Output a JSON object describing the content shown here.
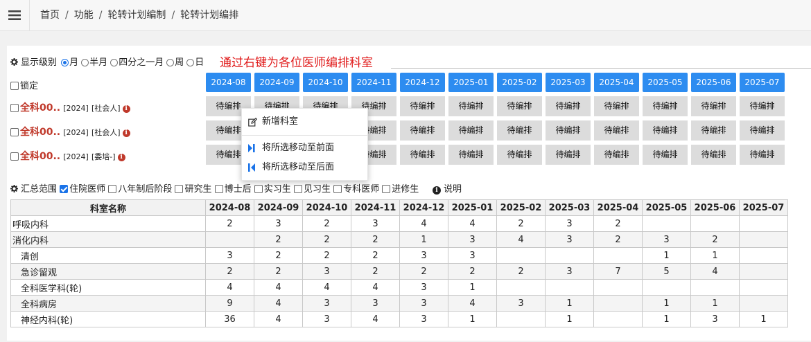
{
  "breadcrumb": [
    "首页",
    "功能",
    "轮转计划编制",
    "轮转计划编排"
  ],
  "display_level": {
    "label": "显示级别",
    "options": [
      "月",
      "半月",
      "四分之一月",
      "周",
      "日"
    ],
    "selected": "月"
  },
  "hint": "通过右键为各位医师编排科室",
  "lock_label": "锁定",
  "months": [
    "2024-08",
    "2024-09",
    "2024-10",
    "2024-11",
    "2024-12",
    "2025-01",
    "2025-02",
    "2025-03",
    "2025-04",
    "2025-05",
    "2025-06",
    "2025-07"
  ],
  "pending_label": "待编排",
  "doctors": [
    {
      "name": "全科00..",
      "year": "[2024]",
      "type": "[社会人]"
    },
    {
      "name": "全科00..",
      "year": "[2024]",
      "type": "[社会人]"
    },
    {
      "name": "全科00..",
      "year": "[2024]",
      "type": "[委培-]"
    }
  ],
  "context_menu": {
    "items": [
      "新增科室",
      "将所选移动至前面",
      "将所选移动至后面"
    ]
  },
  "summary": {
    "label": "汇总范围",
    "filters": [
      {
        "label": "住院医师",
        "checked": true
      },
      {
        "label": "八年制后阶段",
        "checked": false
      },
      {
        "label": "研究生",
        "checked": false
      },
      {
        "label": "博士后",
        "checked": false
      },
      {
        "label": "实习生",
        "checked": false
      },
      {
        "label": "见习生",
        "checked": false
      },
      {
        "label": "专科医师",
        "checked": false
      },
      {
        "label": "进修生",
        "checked": false
      }
    ],
    "help_label": "说明"
  },
  "table": {
    "name_header": "科室名称",
    "rows": [
      {
        "name": "呼吸内科",
        "indent": false,
        "values": [
          "2",
          "3",
          "2",
          "3",
          "4",
          "4",
          "2",
          "3",
          "2",
          "",
          "",
          ""
        ]
      },
      {
        "name": "消化内科",
        "indent": false,
        "values": [
          "",
          "2",
          "2",
          "2",
          "1",
          "3",
          "4",
          "3",
          "2",
          "3",
          "2",
          ""
        ]
      },
      {
        "name": "清创",
        "indent": true,
        "values": [
          "3",
          "2",
          "2",
          "2",
          "3",
          "3",
          "",
          "",
          "",
          "1",
          "1",
          ""
        ]
      },
      {
        "name": "急诊留观",
        "indent": true,
        "values": [
          "2",
          "2",
          "3",
          "2",
          "2",
          "2",
          "2",
          "3",
          "7",
          "5",
          "4",
          ""
        ]
      },
      {
        "name": "全科医学科(轮)",
        "indent": true,
        "values": [
          "4",
          "4",
          "4",
          "4",
          "3",
          "1",
          "",
          "",
          "",
          "",
          "",
          ""
        ]
      },
      {
        "name": "全科病房",
        "indent": true,
        "values": [
          "9",
          "4",
          "3",
          "3",
          "3",
          "4",
          "3",
          "1",
          "",
          "1",
          "1",
          ""
        ]
      },
      {
        "name": "神经内科(轮)",
        "indent": true,
        "values": [
          "36",
          "4",
          "3",
          "4",
          "3",
          "1",
          "",
          "1",
          "",
          "1",
          "3",
          "1"
        ]
      }
    ]
  },
  "colors": {
    "accent": "#2d8cf0",
    "doctor_name": "#c0392b",
    "hint": "#e01818"
  }
}
